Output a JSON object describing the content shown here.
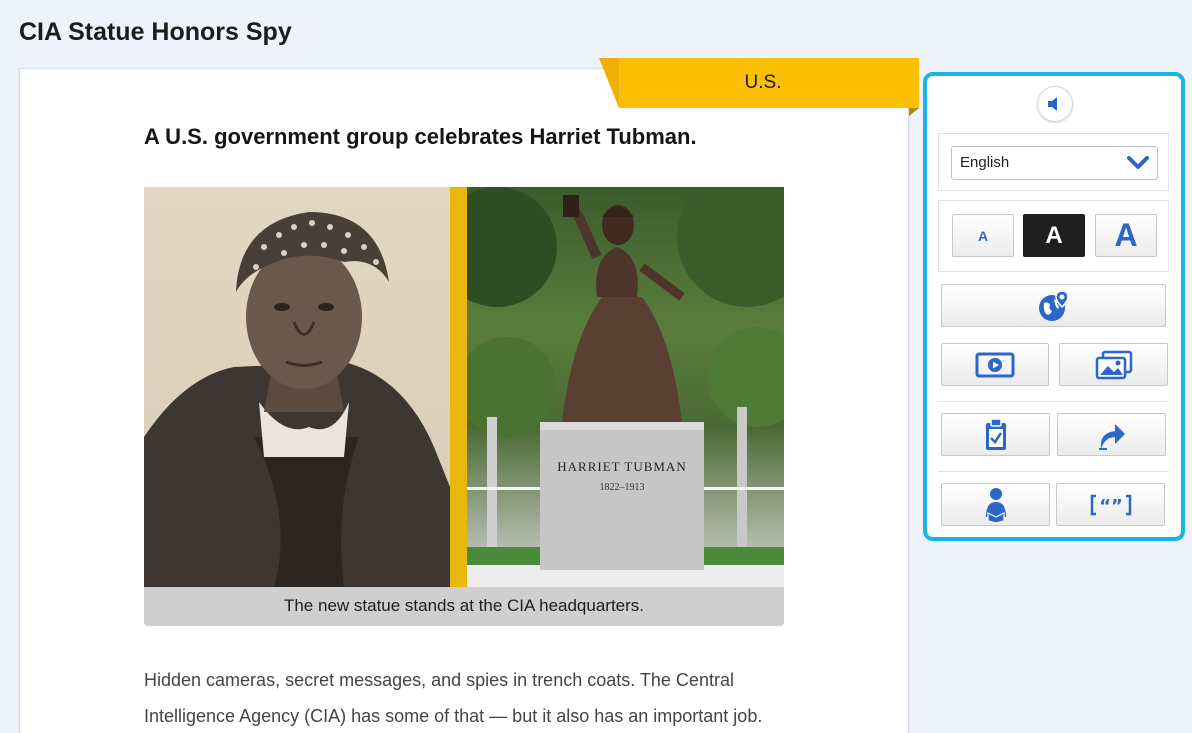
{
  "page": {
    "title": "CIA Statue Honors Spy"
  },
  "article": {
    "section_tag": "U.S.",
    "subtitle": "A U.S. government group celebrates Harriet Tubman.",
    "photo": {
      "caption": "The new statue stands at the CIA headquarters.",
      "statue_inscription": "HARRIET TUBMAN",
      "statue_dates": "1822–1913"
    },
    "body_line_1": "Hidden cameras, secret messages, and spies in trench coats. The Central",
    "body_line_2": "Intelligence Agency (CIA) has some of that — but it also has an important job."
  },
  "tools": {
    "audio_icon": "speaker-icon",
    "language": {
      "selected": "English"
    },
    "text_size": {
      "small": "A",
      "medium": "A",
      "large": "A",
      "selected": "medium"
    },
    "icons": {
      "map": "globe-location-icon",
      "video": "video-play-icon",
      "images": "image-gallery-icon",
      "quiz": "clipboard-check-icon",
      "share": "share-arrow-icon",
      "reading": "reader-icon",
      "cite": "quote-brackets-icon"
    },
    "colors": {
      "accent": "#2b66c9",
      "panel_border": "#19b5e6",
      "tag": "#fbbf05"
    }
  }
}
